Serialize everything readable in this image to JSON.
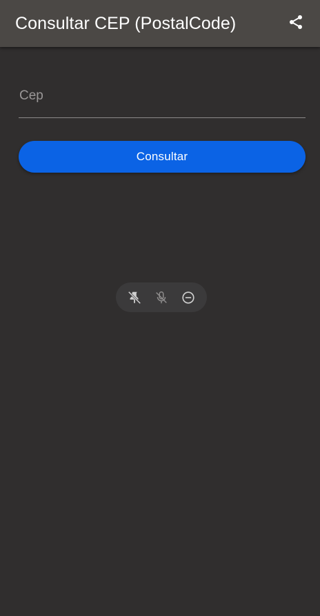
{
  "appbar": {
    "title": "Consultar CEP (PostalCode)",
    "share_icon": "share-icon"
  },
  "form": {
    "cep_placeholder": "Cep",
    "cep_value": "",
    "submit_label": "Consultar"
  },
  "floating_toolbar": {
    "icons": [
      "pin-off-icon",
      "mic-off-icon",
      "minus-circle-icon"
    ]
  },
  "colors": {
    "appbar": "#4b4845",
    "background": "#302e2e",
    "accent": "#0b63e5"
  }
}
